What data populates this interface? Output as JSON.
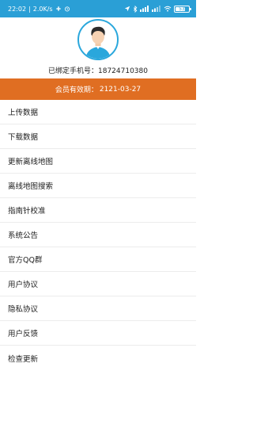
{
  "status_bar": {
    "time": "22:02",
    "net_speed": "2.0K/s",
    "battery_level": "53"
  },
  "profile": {
    "phone_label": "已绑定手机号：",
    "phone_number": "18724710380"
  },
  "membership": {
    "label": "会员有效期：",
    "expiry": "2121-03-27"
  },
  "menu": [
    {
      "label": "上传数据"
    },
    {
      "label": "下载数据"
    },
    {
      "label": "更新离线地图"
    },
    {
      "label": "离线地图搜索"
    },
    {
      "label": "指南针校准"
    },
    {
      "label": "系统公告"
    },
    {
      "label": "官方QQ群"
    },
    {
      "label": "用户协议"
    },
    {
      "label": "隐私协议"
    },
    {
      "label": "用户反馈"
    },
    {
      "label": "检查更新"
    }
  ],
  "colors": {
    "status_bar": "#2a9fd6",
    "banner": "#e06e22",
    "avatar_ring": "#2aa7dc"
  }
}
